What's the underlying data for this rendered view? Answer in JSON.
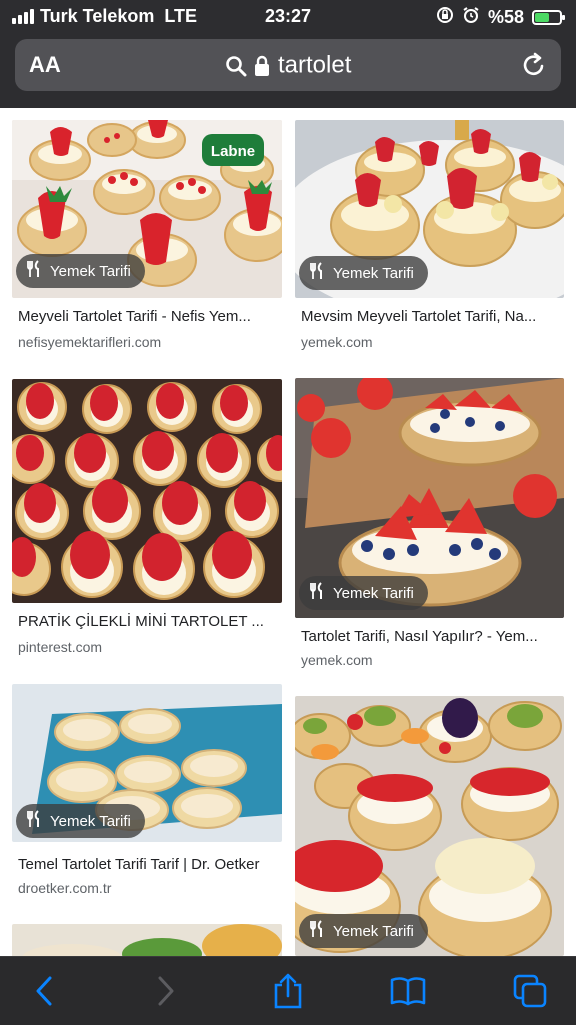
{
  "status_bar": {
    "carrier": "Turk Telekom",
    "network": "LTE",
    "time": "23:27",
    "battery": "%58",
    "battery_level": 0.58,
    "icons": [
      "signal-icon",
      "orientation-lock-icon",
      "alarm-icon",
      "battery-charging-icon"
    ]
  },
  "address_bar": {
    "text_size_label": "AA",
    "url": "tartolet",
    "icons": [
      "search-icon",
      "lock-icon",
      "reload-icon"
    ]
  },
  "results": [
    {
      "title": "Meyveli Tartolet Tarifi - Nefis Yem...",
      "domain": "nefisyemektarifleri.com",
      "badge": "Yemek Tarifi"
    },
    {
      "title": "Mevsim Meyveli Tartolet Tarifi, Na...",
      "domain": "yemek.com",
      "badge": "Yemek Tarifi"
    },
    {
      "title": "PRATİK ÇİLEKLİ MİNİ TARTOLET ...",
      "domain": "pinterest.com",
      "badge": ""
    },
    {
      "title": "Tartolet Tarifi, Nasıl Yapılır? - Yem...",
      "domain": "yemek.com",
      "badge": "Yemek Tarifi"
    },
    {
      "title": "Temel Tartolet Tarifi Tarif | Dr. Oetker",
      "domain": "droetker.com.tr",
      "badge": "Yemek Tarifi"
    },
    {
      "title": "",
      "domain": "",
      "badge": "Yemek Tarifi"
    }
  ],
  "photo_text": {
    "labne_logo": "Labne"
  },
  "toolbar": {
    "icons": [
      "back-icon",
      "forward-icon",
      "share-icon",
      "bookmarks-icon",
      "tabs-icon"
    ]
  },
  "colors": {
    "chrome": "#2d2d30",
    "url_field": "#525256",
    "toolbar_accent": "#0a84ff",
    "battery_green": "#4cd964"
  }
}
